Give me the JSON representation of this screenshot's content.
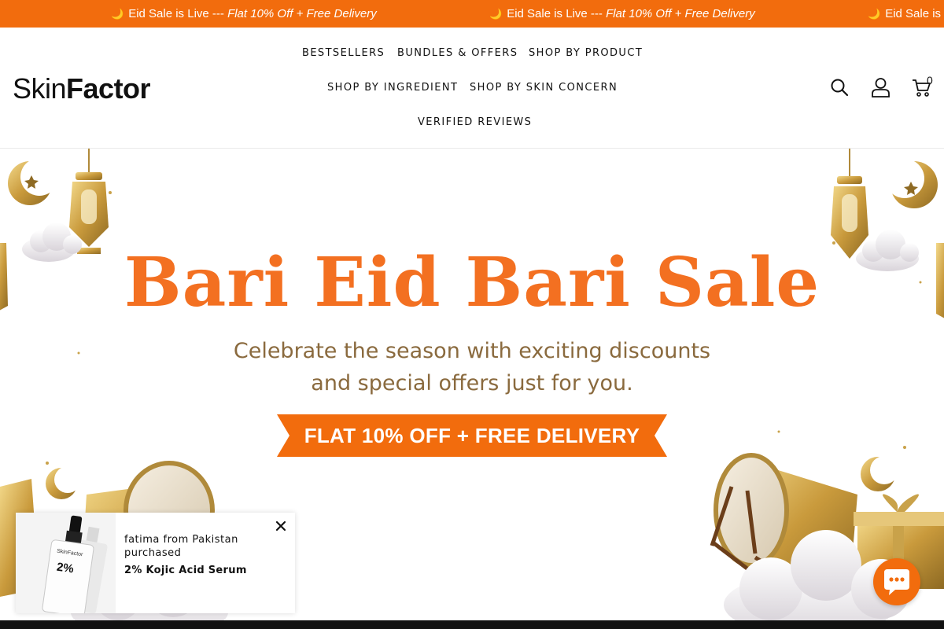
{
  "announcement": {
    "items": [
      {
        "moon": "🌙",
        "prefix": "Eid Sale is Live --- ",
        "offer": "Flat 10% Off + Free Delivery"
      },
      {
        "moon": "🌙",
        "prefix": "Eid Sale is Live --- ",
        "offer": "Flat 10% Off + Free Delivery"
      },
      {
        "moon": "🌙",
        "prefix": "Eid Sale is L",
        "offer": ""
      }
    ]
  },
  "header": {
    "logo": {
      "part1": "Skin",
      "part2": "Factor"
    },
    "nav": [
      {
        "label": "BESTSELLERS"
      },
      {
        "label": "BUNDLES & OFFERS"
      },
      {
        "label": "SHOP BY PRODUCT"
      },
      {
        "label": "SHOP BY INGREDIENT"
      },
      {
        "label": "SHOP BY SKIN CONCERN"
      },
      {
        "label": "VERIFIED REVIEWS"
      }
    ],
    "icons": {
      "search": "search-icon",
      "account": "user-icon",
      "cart": "cart-icon"
    },
    "cart_count": "0"
  },
  "hero": {
    "title": "Bari Eid Bari Sale",
    "subtitle_line1": "Celebrate the season with exciting discounts",
    "subtitle_line2": "and special offers just for you.",
    "cta": "FLAT 10% OFF +  FREE DELIVERY",
    "colors": {
      "accent": "#f37021",
      "gold": "#c9a24a",
      "subtitle": "#8a6a3e"
    }
  },
  "popup": {
    "line1": "fatima from Pakistan purchased",
    "product": "2% Kojic Acid Serum",
    "bottle_brand": "SkinFactor",
    "bottle_percent": "2%"
  },
  "chat": {
    "icon": "chat-icon"
  }
}
